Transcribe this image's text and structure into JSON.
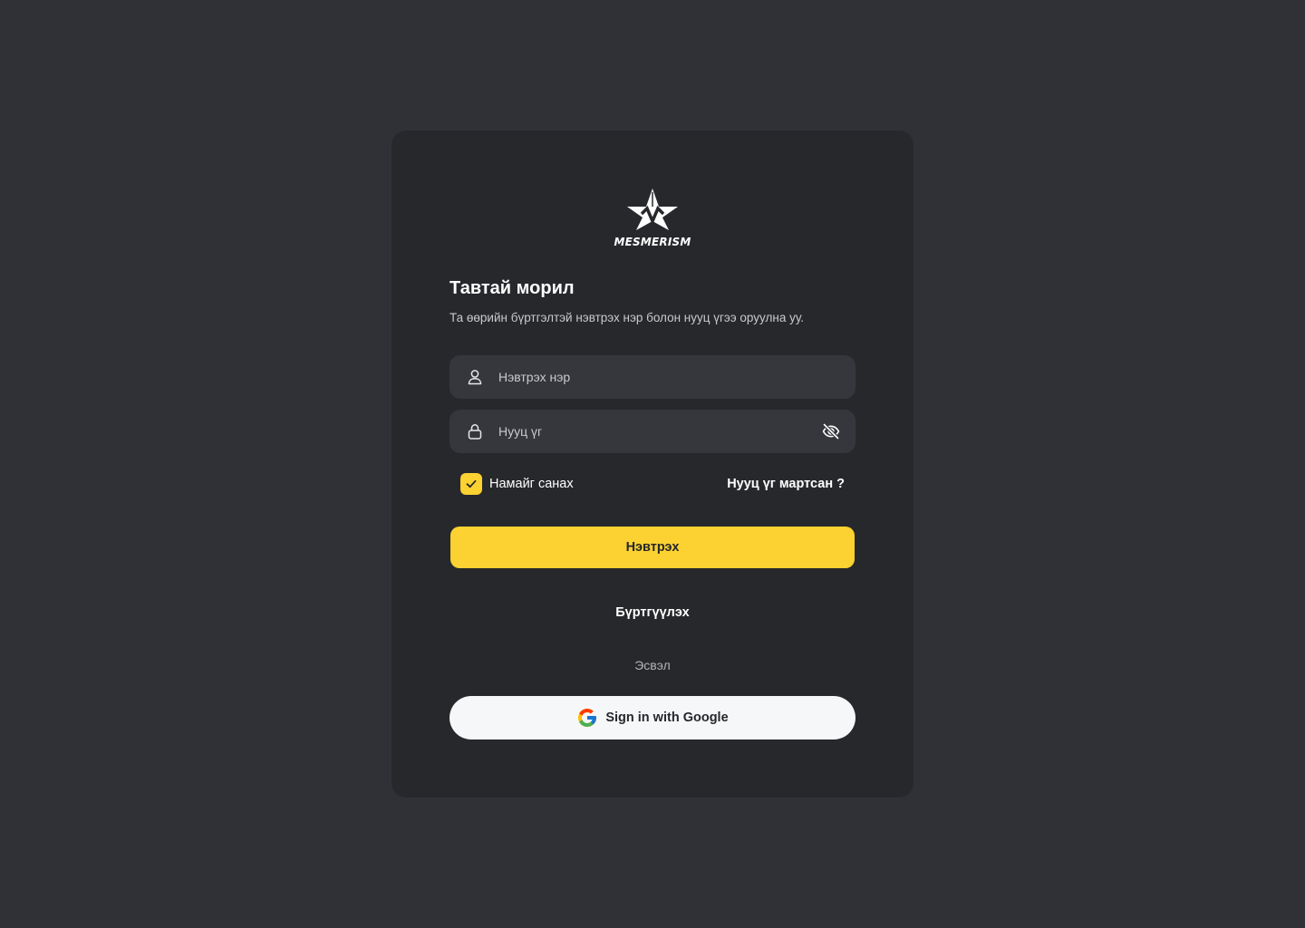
{
  "brand": {
    "name": "MESMERISM",
    "logo_icon": "star-m-logo-icon"
  },
  "login": {
    "title": "Тавтай морил",
    "subtitle": "Та өөрийн бүртгэлтэй нэвтрэх нэр болон нууц үгээ оруулна уу.",
    "username": {
      "icon": "user-icon",
      "placeholder": "Нэвтрэх нэр",
      "value": ""
    },
    "password": {
      "icon": "lock-icon",
      "placeholder": "Нууц үг",
      "value": "",
      "toggle_icon": "eye-off-icon"
    },
    "remember": {
      "label": "Намайг санах",
      "checked": true
    },
    "forgot_label": "Нууц үг мартсан ?",
    "submit_label": "Нэвтрэх",
    "register_label": "Бүртгүүлэх",
    "or_label": "Эсвэл",
    "google": {
      "icon": "google-icon",
      "label": "Sign in with Google"
    }
  },
  "colors": {
    "page_background": "#303136",
    "card_background": "#27282c",
    "input_background": "#36373c",
    "accent": "#fbd231",
    "google_button": "#f6f7f9"
  }
}
